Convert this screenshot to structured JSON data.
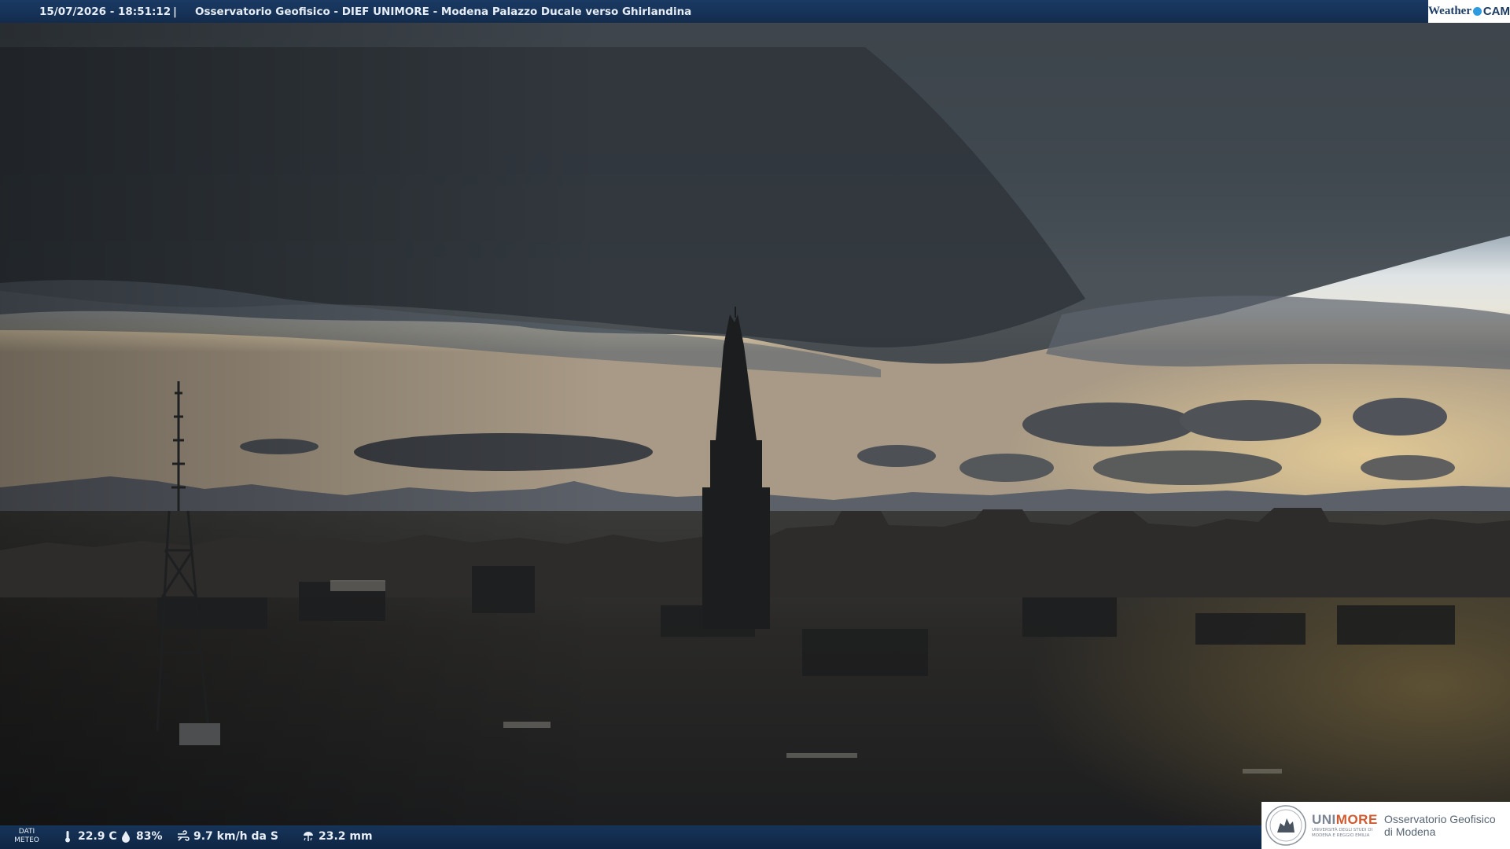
{
  "header": {
    "timestamp": "15/07/2026 - 18:51:12",
    "separator": "|",
    "camera_title": "Osservatorio Geofisico - DIEF UNIMORE - Modena Palazzo Ducale verso Ghirlandina",
    "brand_left": "Weather",
    "brand_right": "CAM"
  },
  "footer": {
    "meteo_label_line1": "DATI",
    "meteo_label_line2": "METEO",
    "temperature": "22.9 C",
    "humidity": "83%",
    "wind": "9.7 km/h da S",
    "rain": "23.2 mm"
  },
  "logo": {
    "uni_prefix": "UNI",
    "uni_suffix": "MORE",
    "uni_sub_line1": "UNIVERSITÀ DEGLI STUDI DI",
    "uni_sub_line2": "MODENA E REGGIO EMILIA",
    "observatory_line1": "Osservatorio Geofisico",
    "observatory_line2": "di Modena"
  },
  "colors": {
    "bar_blue": "#163459",
    "accent_orange": "#d05a30"
  },
  "icons": [
    "thermometer-icon",
    "humidity-drop-icon",
    "wind-icon",
    "rain-gauge-icon",
    "unimore-seal-icon"
  ]
}
